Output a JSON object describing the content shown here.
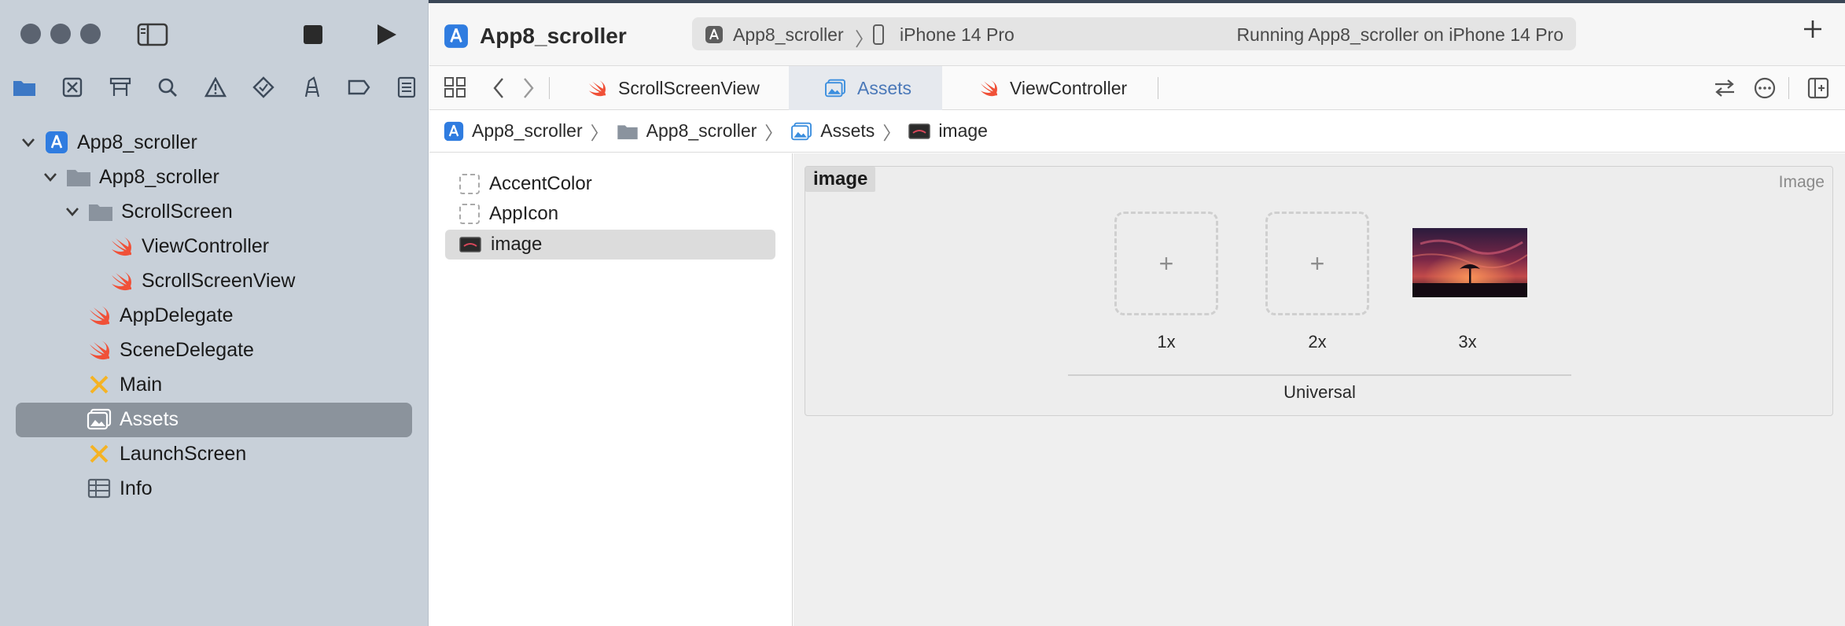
{
  "window": {
    "traffic_lights": [
      "close",
      "minimize",
      "zoom"
    ]
  },
  "toolbar": {
    "project_title": "App8_scroller",
    "scheme_app": "App8_scroller",
    "scheme_device": "iPhone 14 Pro",
    "status": "Running App8_scroller on iPhone 14 Pro"
  },
  "navigator": {
    "icons": [
      "folder-icon",
      "source-control-icon",
      "hierarchy-icon",
      "find-icon",
      "warning-icon",
      "test-icon",
      "debug-icon",
      "breakpoint-icon",
      "report-icon"
    ],
    "tree": [
      {
        "label": "App8_scroller",
        "icon": "xcode-project-icon",
        "expanded": true
      },
      {
        "label": "App8_scroller",
        "icon": "folder-icon",
        "expanded": true
      },
      {
        "label": "ScrollScreen",
        "icon": "folder-icon",
        "expanded": true
      },
      {
        "label": "ViewController",
        "icon": "swift-file-icon"
      },
      {
        "label": "ScrollScreenView",
        "icon": "swift-file-icon"
      },
      {
        "label": "AppDelegate",
        "icon": "swift-file-icon"
      },
      {
        "label": "SceneDelegate",
        "icon": "swift-file-icon"
      },
      {
        "label": "Main",
        "icon": "storyboard-icon"
      },
      {
        "label": "Assets",
        "icon": "asset-catalog-icon",
        "selected": true
      },
      {
        "label": "LaunchScreen",
        "icon": "storyboard-icon"
      },
      {
        "label": "Info",
        "icon": "plist-icon"
      }
    ]
  },
  "tabs": [
    {
      "label": "ScrollScreenView",
      "icon": "swift-file-icon"
    },
    {
      "label": "Assets",
      "icon": "asset-catalog-icon",
      "active": true
    },
    {
      "label": "ViewController",
      "icon": "swift-file-icon"
    }
  ],
  "breadcrumb": [
    {
      "label": "App8_scroller",
      "icon": "xcode-project-icon"
    },
    {
      "label": "App8_scroller",
      "icon": "folder-icon"
    },
    {
      "label": "Assets",
      "icon": "asset-catalog-icon"
    },
    {
      "label": "image",
      "icon": "image-asset-icon"
    }
  ],
  "assets": [
    {
      "label": "AccentColor"
    },
    {
      "label": "AppIcon"
    },
    {
      "label": "image",
      "selected": true
    }
  ],
  "image_set": {
    "name": "image",
    "kind": "Image",
    "slots": [
      {
        "label": "1x",
        "filled": false,
        "placeholder": "+"
      },
      {
        "label": "2x",
        "filled": false,
        "placeholder": "+"
      },
      {
        "label": "3x",
        "filled": true
      }
    ],
    "idiom": "Universal"
  },
  "colors": {
    "sidebar_bg": "#c8d0d9",
    "selection": "#8b939c",
    "swift_orange": "#f05138",
    "accent_blue": "#2f7ce0"
  }
}
